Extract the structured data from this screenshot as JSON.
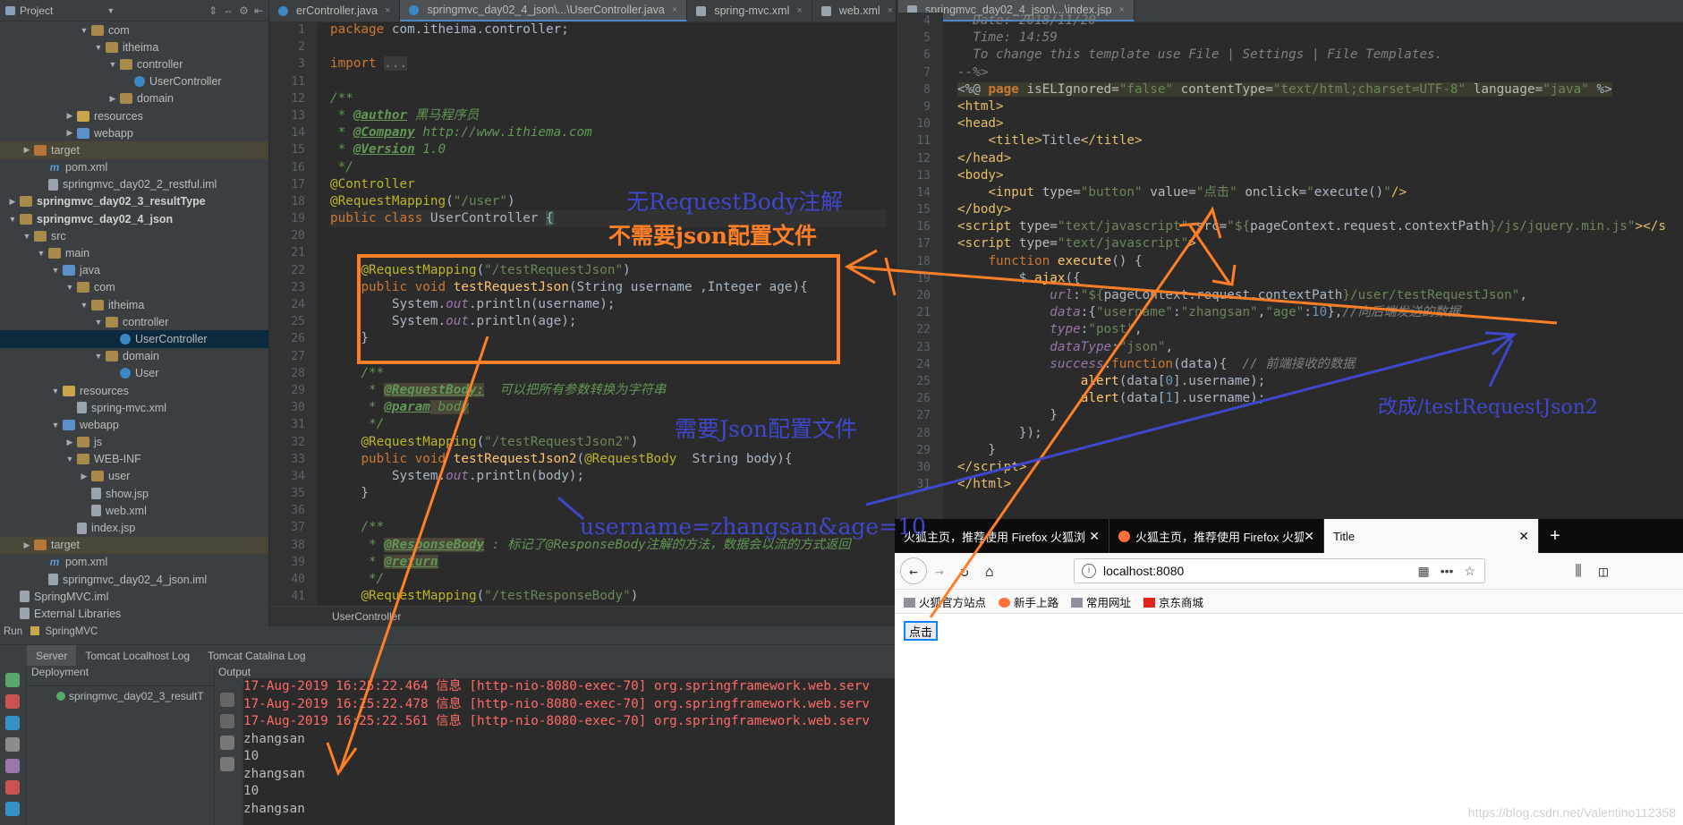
{
  "project_panel": {
    "title": "Project",
    "tree": [
      {
        "indent": 5,
        "twisty": "▼",
        "icon": "folder",
        "label": "com"
      },
      {
        "indent": 6,
        "twisty": "▼",
        "icon": "folder",
        "label": "itheima"
      },
      {
        "indent": 7,
        "twisty": "▼",
        "icon": "folder",
        "label": "controller"
      },
      {
        "indent": 8,
        "twisty": "",
        "icon": "class",
        "label": "UserController"
      },
      {
        "indent": 7,
        "twisty": "▶",
        "icon": "folder",
        "label": "domain"
      },
      {
        "indent": 4,
        "twisty": "▶",
        "icon": "folder-yellow",
        "label": "resources"
      },
      {
        "indent": 4,
        "twisty": "▶",
        "icon": "folder-blue",
        "label": "webapp"
      },
      {
        "indent": 1,
        "twisty": "▶",
        "icon": "folder-orange",
        "label": "target",
        "state": "hl"
      },
      {
        "indent": 2,
        "twisty": "",
        "icon": "m",
        "label": "pom.xml"
      },
      {
        "indent": 2,
        "twisty": "",
        "icon": "file",
        "label": "springmvc_day02_2_restful.iml"
      },
      {
        "indent": 0,
        "twisty": "▶",
        "icon": "folder",
        "label": "springmvc_day02_3_resultType",
        "bold": true
      },
      {
        "indent": 0,
        "twisty": "▼",
        "icon": "folder",
        "label": "springmvc_day02_4_json",
        "bold": true
      },
      {
        "indent": 1,
        "twisty": "▼",
        "icon": "folder",
        "label": "src"
      },
      {
        "indent": 2,
        "twisty": "▼",
        "icon": "folder",
        "label": "main"
      },
      {
        "indent": 3,
        "twisty": "▼",
        "icon": "folder-blue",
        "label": "java"
      },
      {
        "indent": 4,
        "twisty": "▼",
        "icon": "folder",
        "label": "com"
      },
      {
        "indent": 5,
        "twisty": "▼",
        "icon": "folder",
        "label": "itheima"
      },
      {
        "indent": 6,
        "twisty": "▼",
        "icon": "folder",
        "label": "controller"
      },
      {
        "indent": 7,
        "twisty": "",
        "icon": "class",
        "label": "UserController",
        "state": "sel"
      },
      {
        "indent": 6,
        "twisty": "▼",
        "icon": "folder",
        "label": "domain"
      },
      {
        "indent": 7,
        "twisty": "",
        "icon": "class",
        "label": "User"
      },
      {
        "indent": 3,
        "twisty": "▼",
        "icon": "folder-yellow",
        "label": "resources"
      },
      {
        "indent": 4,
        "twisty": "",
        "icon": "file",
        "label": "spring-mvc.xml"
      },
      {
        "indent": 3,
        "twisty": "▼",
        "icon": "folder-blue",
        "label": "webapp"
      },
      {
        "indent": 4,
        "twisty": "▶",
        "icon": "folder",
        "label": "js"
      },
      {
        "indent": 4,
        "twisty": "▼",
        "icon": "folder",
        "label": "WEB-INF"
      },
      {
        "indent": 5,
        "twisty": "▶",
        "icon": "folder",
        "label": "user"
      },
      {
        "indent": 5,
        "twisty": "",
        "icon": "file",
        "label": "show.jsp"
      },
      {
        "indent": 5,
        "twisty": "",
        "icon": "file",
        "label": "web.xml"
      },
      {
        "indent": 4,
        "twisty": "",
        "icon": "file",
        "label": "index.jsp"
      },
      {
        "indent": 1,
        "twisty": "▶",
        "icon": "folder-orange",
        "label": "target",
        "state": "hl"
      },
      {
        "indent": 2,
        "twisty": "",
        "icon": "m",
        "label": "pom.xml"
      },
      {
        "indent": 2,
        "twisty": "",
        "icon": "file",
        "label": "springmvc_day02_4_json.iml"
      },
      {
        "indent": 0,
        "twisty": "",
        "icon": "file",
        "label": "SpringMVC.iml"
      },
      {
        "indent": 0,
        "twisty": "",
        "icon": "file",
        "label": "External Libraries"
      }
    ]
  },
  "editor_left": {
    "tabs": [
      {
        "label": "erController.java",
        "active": false
      },
      {
        "label": "springmvc_day02_4_json\\...\\UserController.java",
        "active": true
      },
      {
        "label": "spring-mvc.xml",
        "active": false
      },
      {
        "label": "web.xml",
        "active": false
      }
    ],
    "line_numbers": [
      "1",
      "2",
      "3",
      "11",
      "12",
      "13",
      "14",
      "15",
      "16",
      "17",
      "18",
      "19",
      "20",
      "21",
      "22",
      "23",
      "24",
      "25",
      "26",
      "27",
      "28",
      "29",
      "30",
      "31",
      "32",
      "33",
      "34",
      "35",
      "36",
      "37",
      "38",
      "39",
      "40",
      "41"
    ],
    "breadcrumb": "UserController"
  },
  "editor_right": {
    "tabs": [
      {
        "label": "springmvc_day02_4_json\\...\\index.jsp",
        "active": true
      }
    ],
    "line_numbers": [
      "4",
      "5",
      "6",
      "7",
      "8",
      "9",
      "10",
      "11",
      "12",
      "13",
      "14",
      "15",
      "16",
      "17",
      "18",
      "19",
      "20",
      "21",
      "22",
      "23",
      "24",
      "25",
      "26",
      "27",
      "28",
      "29",
      "30",
      "31"
    ]
  },
  "run_panel": {
    "title": "Run",
    "config": "SpringMVC",
    "tabs": [
      "Server",
      "Tomcat Localhost Log",
      "Tomcat Catalina Log"
    ],
    "deployment_header": "Deployment",
    "output_header": "Output",
    "deployment_item": "springmvc_day02_3_resultT",
    "output_lines": [
      {
        "text": "17-Aug-2019 16:25:22.464 信息 [http-nio-8080-exec-70] org.springframework.web.serv",
        "type": "red"
      },
      {
        "text": "17-Aug-2019 16:25:22.478 信息 [http-nio-8080-exec-70] org.springframework.web.serv",
        "type": "red"
      },
      {
        "text": "17-Aug-2019 16:25:22.561 信息 [http-nio-8080-exec-70] org.springframework.web.serv",
        "type": "red"
      },
      {
        "text": "zhangsan",
        "type": "wht"
      },
      {
        "text": "10",
        "type": "wht"
      },
      {
        "text": "zhangsan",
        "type": "wht"
      },
      {
        "text": "10",
        "type": "wht"
      },
      {
        "text": "zhangsan",
        "type": "wht"
      }
    ]
  },
  "browser": {
    "tabs": [
      {
        "label": "火狐主页，推荐使用 Firefox 火狐浏",
        "active": false
      },
      {
        "label": "火狐主页，推荐使用 Firefox 火狐浏",
        "active": false
      },
      {
        "label": "Title",
        "active": true
      }
    ],
    "url": "localhost:8080",
    "bookmarks": [
      "火狐官方站点",
      "新手上路",
      "常用网址",
      "京东商城"
    ],
    "page_button": "点击",
    "watermark": "https://blog.csdn.net/Valentino112358"
  },
  "annotations": {
    "no_requestbody_title": "无RequestBody注解",
    "no_json_config": "不需要json配置文件",
    "needs_json_config": "需要Json配置文件",
    "request_body_sample": "username=zhangsan&age=10",
    "change_to": "改成/testRequestJson2",
    "colors": {
      "orange": "#ff7f27",
      "blue": "#3f48cc"
    }
  }
}
